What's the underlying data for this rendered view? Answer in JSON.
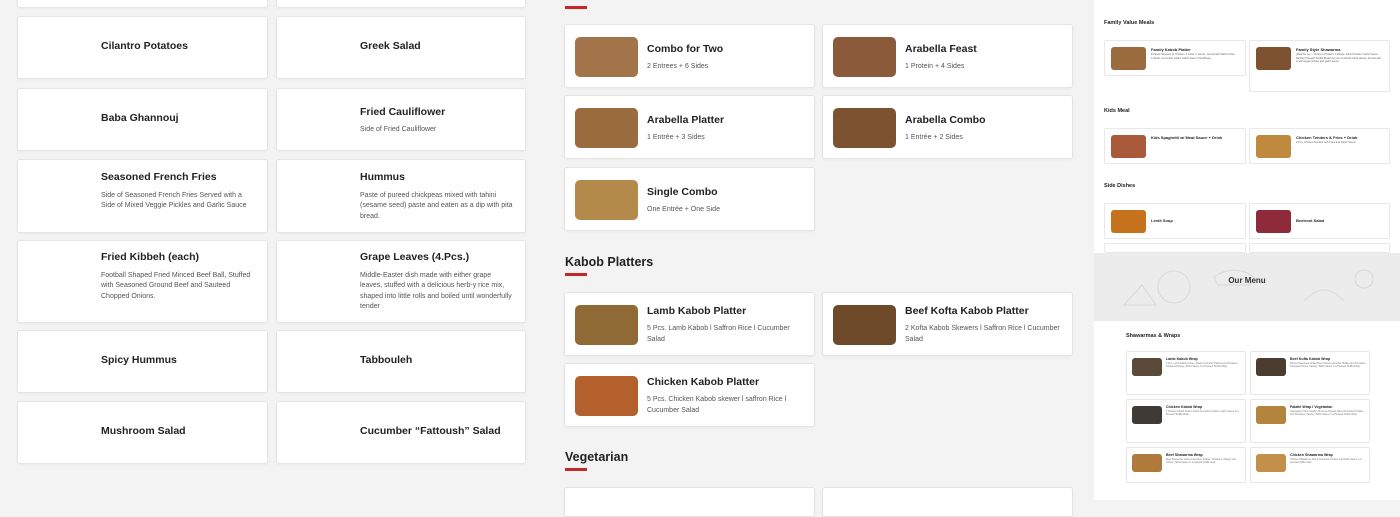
{
  "left_menu": [
    {
      "title": "Cilantro Potatoes",
      "desc": ""
    },
    {
      "title": "Greek Salad",
      "desc": ""
    },
    {
      "title": "Baba Ghannouj",
      "desc": ""
    },
    {
      "title": "Fried Cauliflower",
      "desc": "Side of Fried Cauliflower"
    },
    {
      "title": "Seasoned French Fries",
      "desc": "Side of Seasoned French Fries Served with a Side of Mixed Veggie Pickles and Garlic Sauce"
    },
    {
      "title": "Hummus",
      "desc": "Paste of pureed chickpeas mixed with tahini (sesame seed) paste and eaten as a dip with pita bread."
    },
    {
      "title": "Fried Kibbeh (each)",
      "desc": "Football Shaped Fried Minced Beef Ball, Stuffed with Seasoned Ground Beef and Sauteed Chopped Onions."
    },
    {
      "title": "Grape Leaves (4.Pcs.)",
      "desc": "Middle-Easter dish made with either grape leaves, stuffed with a delicious herb-y rice mix, shaped into little rolls and boiled until wonderfully tender"
    },
    {
      "title": "Spicy Hummus",
      "desc": ""
    },
    {
      "title": "Tabbouleh",
      "desc": ""
    },
    {
      "title": "Mushroom Salad",
      "desc": ""
    },
    {
      "title": "Cucumber “Fattoush” Salad",
      "desc": ""
    }
  ],
  "combos": [
    {
      "title": "Combo for Two",
      "desc": "2 Entrees + 6 Sides",
      "color": "#a3744a"
    },
    {
      "title": "Arabella Feast",
      "desc": "1 Protein + 4 Sides",
      "color": "#8a5a3a"
    },
    {
      "title": "Arabella Platter",
      "desc": "1 Entrée + 3 Sides",
      "color": "#9a6b3d"
    },
    {
      "title": "Arabella Combo",
      "desc": "1 Entrée + 2 Sides",
      "color": "#7d5230"
    },
    {
      "title": "Single Combo",
      "desc": "One Entrée + One Side",
      "color": "#b48a4a"
    }
  ],
  "kabob_section": "Kabob Platters",
  "kabob_platters": [
    {
      "title": "Lamb Kabob Platter",
      "desc": "5 Pcs. Lamb Kabob l Saffron Rice l Cucumber Salad",
      "color": "#8f6a34"
    },
    {
      "title": "Beef Kofta Kabob Platter",
      "desc": "2 Kofta Kabob Skewers l Saffron Rice l Cucumber Salad",
      "color": "#6f4a2a"
    },
    {
      "title": "Chicken Kabob Platter",
      "desc": "5 Pcs. Chicken Kabob skewer l saffron Rice l Cucumber Salad",
      "color": "#b4602c"
    }
  ],
  "vegetarian_section": "Vegetarian",
  "right": {
    "family_title": "Family Value Meals",
    "family": [
      {
        "name": "Family Kabob Platter",
        "desc": "8 Kabob Skewers (2 Chicken, 4 Kofta, 2 Lamb), served with Saffron Rice, Tzatziki, Cucumber Salad, Garlic Sauce, Pita Bread."
      },
      {
        "name": "Family Style Shawarma",
        "desc": "(Ideal for 4+) – Choice of Protein, 4 Wraps, Diced Pickles, Garlic Sauce, Parsley Pressed Tortilla Bread cut into small bite sized pieces, served with small veggie pickles and garlic sauce."
      }
    ],
    "kids_title": "Kids Meal",
    "kids": [
      {
        "name": "Kids Spaghetti w/ Meat Sauce + Drink",
        "desc": ""
      },
      {
        "name": "Chicken Tenders & Fries + Drink",
        "desc": "2 Pcs. Chicken Tenders with Fries and Garlic Sauce"
      }
    ],
    "side_title": "Side Dishes",
    "sides": [
      {
        "name": "Lentil Soup",
        "desc": ""
      },
      {
        "name": "Beetroot Salad",
        "desc": ""
      }
    ],
    "banner": "Our Menu",
    "wraps_title": "Shawarmas & Wraps",
    "wraps": [
      {
        "name": "Lamb Kabob Wrap",
        "desc": "5 Pcs. Lamb Kabob Cubes, Diced Cucumber Pickles and Tomatoes, Chopped Parsley, Tahini Sauce in a Pressed Tortilla Wrap."
      },
      {
        "name": "Beef Kofta Kabob Wrap",
        "desc": "Minced Seasoned Grilled Beef, Diced Cucumber Pickles and Tomatoes, Chopped Onions, Parsley, Tahini Sauce in a Pressed Tortilla Wrap."
      },
      {
        "name": "Chicken Kabob Wrap",
        "desc": "5 Chicken Kabob Cubes, Diced Cucumber Pickles, Garlic Sauce in a Pressed Tortilla Wrap."
      },
      {
        "name": "Falafel Wrap l Vegetarian",
        "desc": "Vegetarian 5 Pcs. Falafel, Hummus Spread, Diced Cucumber Pickles and Tomatoes, Parsley, Tahini Sauce in a Pressed Tortilla Wrap."
      },
      {
        "name": "Beef Shawarma Wrap",
        "desc": "Beef Shawarma, Diced Cucumber Pickles, Tomatoes, Parsley and Onions, Tahini Sauce in a pressed tortilla wrap."
      },
      {
        "name": "Chicken Shawarma Wrap",
        "desc": "Chicken Shawarma, Diced Cucumber Pickles and Garlic Sauce in a pressed tortilla wrap."
      }
    ]
  },
  "colors": {
    "accent": "#c62828"
  }
}
